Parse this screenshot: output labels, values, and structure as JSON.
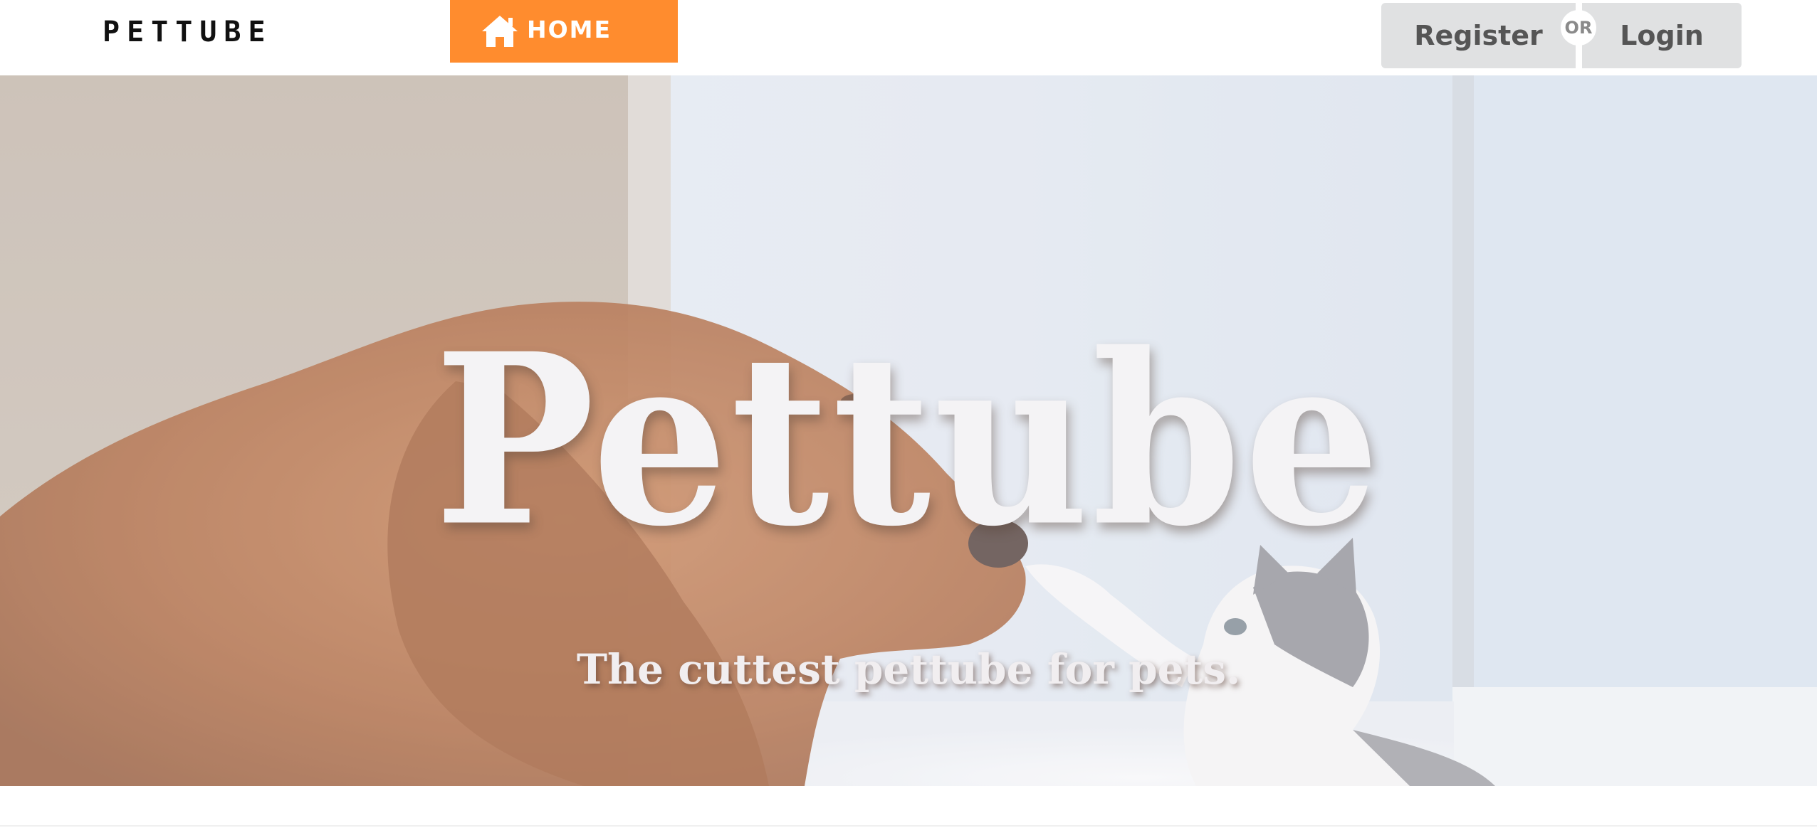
{
  "navbar": {
    "brand": "PETTUBE",
    "home_label": "HOME",
    "home_icon": "home-icon",
    "register_label": "Register",
    "or_label": "OR",
    "login_label": "Login"
  },
  "hero": {
    "title": "Pettube",
    "subtitle": "The cuttest pettube for pets."
  },
  "colors": {
    "accent": "#ff8c2e",
    "button_bg": "#e0e1e2",
    "button_text": "#555555",
    "hero_text": "#f4f3f5"
  }
}
